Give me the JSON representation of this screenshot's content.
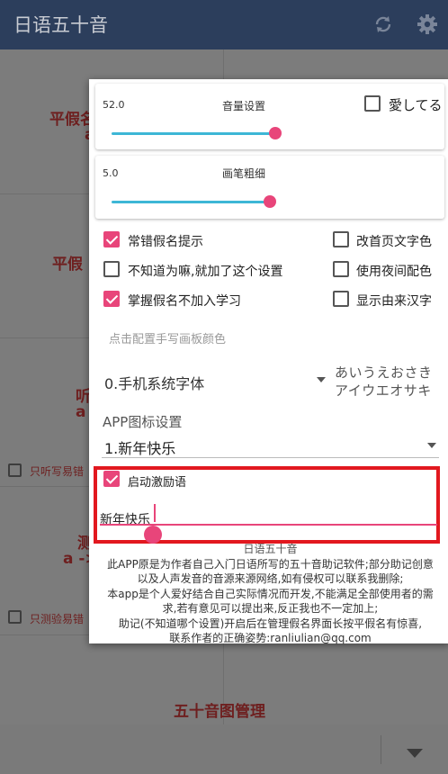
{
  "appbar": {
    "title": "日语五十音",
    "refresh_icon": "refresh-icon",
    "settings_icon": "gear-icon"
  },
  "background": {
    "cell_hiragana_a": "平假名",
    "cell_hiragana_a_sub": "a",
    "cell_hiragana_b": "平假",
    "cell_listen": "听",
    "cell_listen_sub": "a",
    "listen_check_label": "只听写易错",
    "cell_test": "测",
    "cell_test_sub": "a ->",
    "test_check_label": "只测验易错",
    "cell_manage": "五十音图管理"
  },
  "dialog": {
    "volume": {
      "value": "52.0",
      "title": "音量设置",
      "level": 0.52
    },
    "love_label": "愛してる",
    "love_checked": false,
    "brush": {
      "value": "5.0",
      "title": "画笔粗细",
      "level": 0.5
    },
    "options": [
      {
        "label": "常错假名提示",
        "checked": true
      },
      {
        "label": "改首页文字色",
        "checked": false
      },
      {
        "label": "不知道为嘛,就加了这个设置",
        "checked": false
      },
      {
        "label": "使用夜间配色",
        "checked": false
      },
      {
        "label": "掌握假名不加入学习",
        "checked": true
      },
      {
        "label": "显示由来汉字",
        "checked": false
      }
    ],
    "handwriting_color_hint": "点击配置手写画板颜色",
    "font_select": "0.手机系统字体",
    "kana_preview_1": "あいうえおさき",
    "kana_preview_2": "アイウエオサキ",
    "app_icon_section": "APP图标设置",
    "app_icon_select": "1.新年快乐",
    "motivation_label": "启动激励语",
    "motivation_checked": true,
    "motivation_text": "新年快乐",
    "about_title": "日语五十音",
    "about_lines": [
      "此APP原是为作者自己入门日语所写的五十音助记软件;部分助记创意",
      "以及人声发音的音源来源网络,如有侵权可以联系我删除;",
      "本app是个人爱好结合自己实际情况而开发,不能满足全部使用者的需",
      "求,若有意见可以提出来,反正我也不一定加上;",
      "助记(不知道哪个设置)开启后在管理假名界面长按平假名有惊喜,",
      "联系作者的正确姿势:ranliulian@qq.com"
    ]
  },
  "colors": {
    "appbar": "#2c3e5c",
    "accent": "#e8457a",
    "track": "#3db7d6",
    "highlight_box": "#e2181f"
  }
}
